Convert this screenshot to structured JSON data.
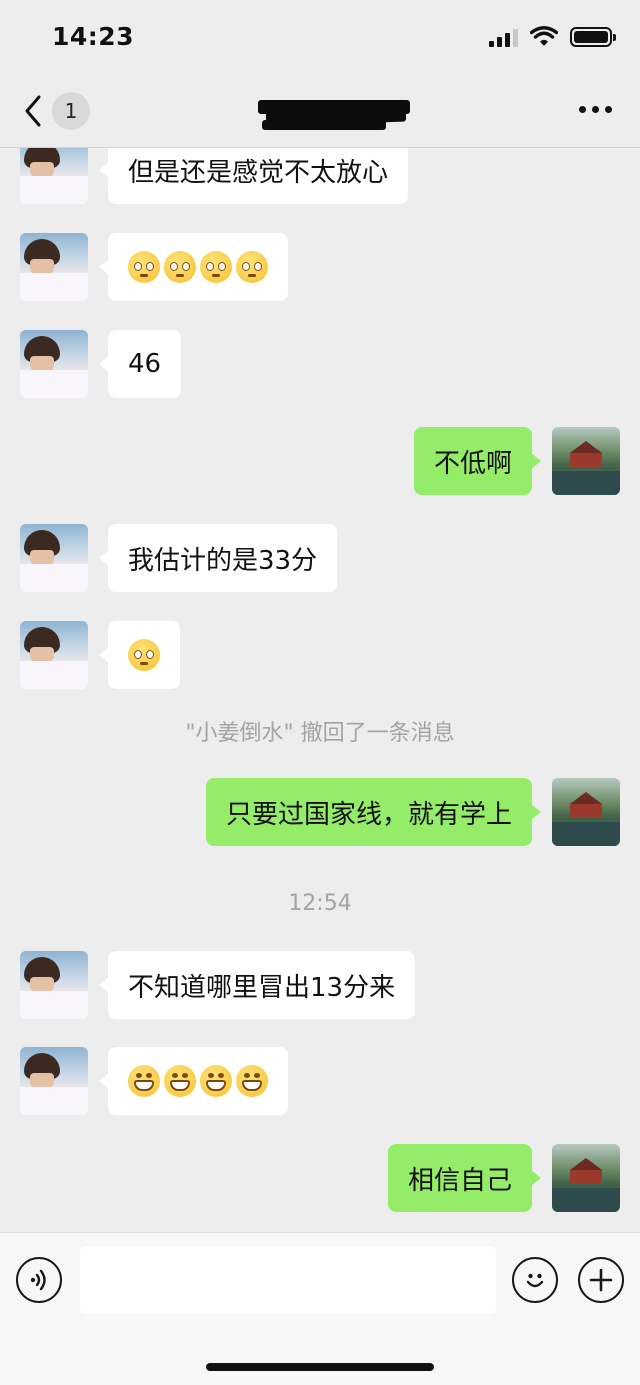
{
  "status_bar": {
    "time": "14:23"
  },
  "nav": {
    "unread_count": "1",
    "title": ""
  },
  "messages": [
    {
      "side": "left",
      "text": "但是还是感觉不太放心"
    },
    {
      "side": "left",
      "emoji": "worried-face",
      "emoji_count": 4
    },
    {
      "side": "left",
      "text": "46"
    },
    {
      "side": "right",
      "text": "不低啊"
    },
    {
      "side": "left",
      "text": "我估计的是33分"
    },
    {
      "side": "left",
      "emoji": "worried-face",
      "emoji_count": 1
    },
    {
      "side": "right",
      "text": "只要过国家线，就有学上"
    },
    {
      "side": "left",
      "text": "不知道哪里冒出13分来"
    },
    {
      "side": "left",
      "emoji": "grinning-face",
      "emoji_count": 4
    },
    {
      "side": "right",
      "text": "相信自己"
    }
  ],
  "system": {
    "recall_note": "\"小姜倒水\" 撤回了一条消息",
    "timestamp": "12:54"
  },
  "input": {
    "value": "",
    "placeholder": ""
  }
}
